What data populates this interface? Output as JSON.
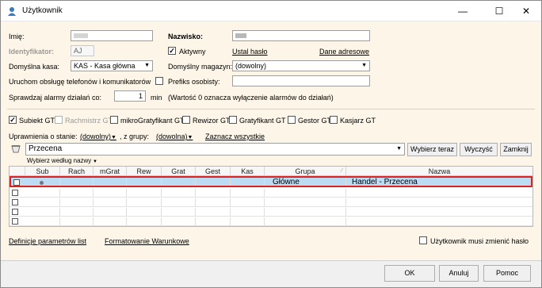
{
  "window": {
    "title": "Użytkownik",
    "minimize": "—",
    "maximize": "☐",
    "close": "✕"
  },
  "form": {
    "imie_label": "Imię:",
    "nazwisko_label": "Nazwisko:",
    "identyfikator_label": "Identyfikator:",
    "identyfikator_value": "AJ",
    "aktywny_label": "Aktywny",
    "ustal_haslo": "Ustal hasło",
    "dane_adresowe": "Dane adresowe",
    "kasa_label": "Domyślna kasa:",
    "kasa_value": "KAS - Kasa główna",
    "magazyn_label": "Domyślny magazyn:",
    "magazyn_value": "(dowolny)",
    "telefony_label": "Uruchom obsługę telefonów i komunikatorów",
    "prefiks_label": "Prefiks osobisty:",
    "alarmy_label": "Sprawdzaj alarmy działań co:",
    "alarmy_value": "1",
    "alarmy_unit": "min",
    "alarmy_note": "(Wartość 0 oznacza wyłączenie alarmów do działań)"
  },
  "roles": [
    {
      "label": "Subiekt GT",
      "checked": true,
      "disabled": false
    },
    {
      "label": "Rachmistrz GT",
      "checked": false,
      "disabled": true
    },
    {
      "label": "mikroGratyfikant GT",
      "checked": false,
      "disabled": false
    },
    {
      "label": "Rewizor GT",
      "checked": false,
      "disabled": false
    },
    {
      "label": "Gratyfikant GT",
      "checked": false,
      "disabled": false
    },
    {
      "label": "Gestor GT",
      "checked": false,
      "disabled": false
    },
    {
      "label": "Kasjarz GT",
      "checked": false,
      "disabled": false
    }
  ],
  "permissions": {
    "stan_label": "Uprawnienia o stanie:",
    "stan_value": "(dowolny)",
    "grupa_label": ", z grupy:",
    "grupa_value": "(dowolna)",
    "zaznacz": "Zaznacz wszystkie",
    "search_value": "Przecena",
    "wybierz_wg": "Wybierz według nazwy",
    "btn_wybierz": "Wybierz teraz",
    "btn_wyczysc": "Wyczyść",
    "btn_zamknij": "Zamknij"
  },
  "grid": {
    "columns": [
      "Sub",
      "Rach",
      "mGrat",
      "Rew",
      "Grat",
      "Gest",
      "Kas",
      "Grupa",
      "Nazwa"
    ],
    "rows": [
      {
        "sub": "●",
        "grupa": "Główne",
        "nazwa": "Handel - Przecena",
        "selected": true
      },
      {
        "sub": "",
        "grupa": "",
        "nazwa": "",
        "selected": false
      },
      {
        "sub": "",
        "grupa": "",
        "nazwa": "",
        "selected": false
      },
      {
        "sub": "",
        "grupa": "",
        "nazwa": "",
        "selected": false
      },
      {
        "sub": "",
        "grupa": "",
        "nazwa": "",
        "selected": false
      }
    ]
  },
  "links": {
    "definicje": "Definicje parametrów list",
    "formatowanie": "Formatowanie Warunkowe"
  },
  "musi_zmienic": "Użytkownik musi zmienić hasło",
  "buttons": {
    "ok": "OK",
    "anuluj": "Anuluj",
    "pomoc": "Pomoc"
  },
  "colors": {
    "background": "#fdf5e7",
    "selection": "#bcdcf4",
    "highlight_border": "#dd2222"
  }
}
